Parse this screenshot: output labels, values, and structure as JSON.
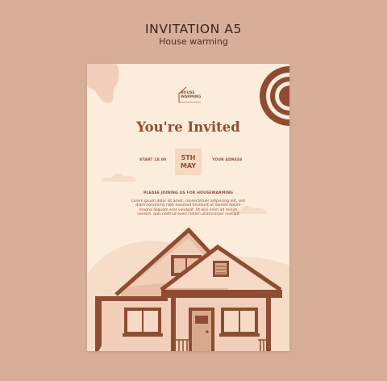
{
  "header": {
    "title": "INVITATION A5",
    "subtitle": "House warming"
  },
  "card": {
    "logo_text": "HOUSE\nWARMING",
    "headline": "You're Invited",
    "start_label": "START 18.00",
    "date_line1": "5TH",
    "date_line2": "MAY",
    "address_label": "YOUR ADRESS",
    "join_text": "PLEASE JOINING US FOR HOUSEWARMING",
    "body_text": "Lorem ipsum dolor sit amet, consectetuer adipiscing elit, sed diam nonummy nibh euismod tincidunt ut laoreet dolore magna aliquam erat volutpat. Ut wisi enim ad minim veniam, quis nostrud exerci tation ullamcorper suscipit"
  },
  "colors": {
    "background": "#d7ae98",
    "card": "#fcecdc",
    "accent": "#8e4c33",
    "peach": "#f6d9c0"
  }
}
